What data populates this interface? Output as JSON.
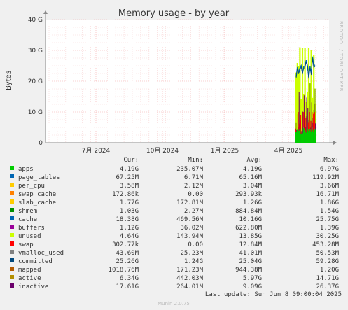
{
  "chart_data": {
    "type": "line",
    "title": "Memory usage - by year",
    "ylabel": "Bytes",
    "xlabel": "",
    "ylim": [
      0,
      40
    ],
    "y_unit": "G",
    "y_ticks": [
      "0",
      "10 G",
      "20 G",
      "30 G",
      "40 G"
    ],
    "x_ticks": [
      "7月 2024",
      "10月 2024",
      "1月 2025",
      "4月 2025"
    ],
    "grid": true,
    "legend_headers": [
      "Cur:",
      "Min:",
      "Avg:",
      "Max:"
    ],
    "series": [
      {
        "name": "apps",
        "color": "#00cc00",
        "cur": "4.19G",
        "min": "235.07M",
        "avg": "4.19G",
        "max": "6.97G"
      },
      {
        "name": "page_tables",
        "color": "#0066b3",
        "cur": "67.25M",
        "min": "6.71M",
        "avg": "65.16M",
        "max": "119.92M"
      },
      {
        "name": "per_cpu",
        "color": "#ff8000",
        "cur": "3.58M",
        "min": "2.12M",
        "avg": "3.04M",
        "max": "3.66M"
      },
      {
        "name": "swap_cache",
        "color": "#ffcc00",
        "cur": "172.86k",
        "min": "0.00",
        "avg": "293.93k",
        "max": "16.71M"
      },
      {
        "name": "slab_cache",
        "color": "#330099",
        "cur": "1.77G",
        "min": "172.81M",
        "avg": "1.26G",
        "max": "1.86G"
      },
      {
        "name": "shmem",
        "color": "#990099",
        "cur": "1.03G",
        "min": "2.27M",
        "avg": "884.84M",
        "max": "1.54G"
      },
      {
        "name": "cache",
        "color": "#ccff00",
        "cur": "18.38G",
        "min": "469.56M",
        "avg": "10.16G",
        "max": "25.75G"
      },
      {
        "name": "buffers",
        "color": "#ff0000",
        "cur": "1.12G",
        "min": "36.02M",
        "avg": "622.80M",
        "max": "1.39G"
      },
      {
        "name": "unused",
        "color": "#808080",
        "cur": "4.64G",
        "min": "143.94M",
        "avg": "13.85G",
        "max": "30.25G"
      },
      {
        "name": "swap",
        "color": "#008f00",
        "cur": "302.77k",
        "min": "0.00",
        "avg": "12.84M",
        "max": "453.28M"
      },
      {
        "name": "vmalloc_used",
        "color": "#00487d",
        "cur": "43.60M",
        "min": "25.23M",
        "avg": "41.01M",
        "max": "50.53M"
      },
      {
        "name": "committed",
        "color": "#b35a00",
        "cur": "25.26G",
        "min": "1.24G",
        "avg": "25.04G",
        "max": "59.28G"
      },
      {
        "name": "mapped",
        "color": "#b38f00",
        "cur": "1018.76M",
        "min": "171.23M",
        "avg": "944.38M",
        "max": "1.20G"
      },
      {
        "name": "active",
        "color": "#6b006b",
        "cur": "6.34G",
        "min": "442.03M",
        "avg": "5.97G",
        "max": "14.71G"
      },
      {
        "name": "inactive",
        "color": "#8fb300",
        "cur": "17.61G",
        "min": "264.01M",
        "avg": "9.09G",
        "max": "26.37G"
      }
    ],
    "legend_swatch_colors": [
      "#00cc00",
      "#0066b3",
      "#ffcc00",
      "#ff8000",
      "#ffcc00",
      "#008f00",
      "#0066b3",
      "#990099",
      "#ccff00",
      "#ff0000",
      "#808080",
      "#00487d",
      "#b35a00",
      "#b38f00",
      "#6b006b",
      "#ff0000"
    ],
    "stack_top_values": [
      [
        22.8,
        25.9,
        24.8,
        31.0,
        14.2,
        30.8,
        15.7,
        30.9,
        13.2,
        16.6,
        30.7,
        15.4,
        30.2,
        14.6,
        28.6,
        12.8
      ]
    ],
    "committed_values": [
      21.4,
      24.6,
      22.8,
      24.3,
      25.1,
      22.7,
      24.7,
      25.0,
      26.8,
      25.0,
      21.3,
      24.8,
      22.5,
      28.0,
      24.9,
      25.3
    ],
    "cache_values": [
      4.6,
      3.9,
      12.4,
      6.2,
      9.0,
      4.1,
      19.8,
      10.2,
      8.1,
      21.7,
      6.5,
      17.3,
      7.1,
      20.9,
      9.4,
      18.4
    ],
    "active_values": [
      4.1,
      9.3,
      16.5,
      7.2,
      3.8,
      10.1,
      15.4,
      5.0,
      14.7,
      11.3,
      8.7,
      4.9,
      13.1,
      6.4,
      12.6,
      6.3
    ],
    "inactive_values": [
      6.4,
      2.8,
      5.1,
      15.2,
      3.2,
      4.9,
      9.9,
      4.3,
      8.6,
      11.2,
      7.5,
      19.3,
      5.4,
      8.1,
      10.7,
      17.6
    ],
    "apps_values": [
      3.6,
      4.2,
      3.9,
      4.4,
      2.9,
      3.1,
      4.7,
      4.0,
      3.3,
      4.6,
      3.8,
      4.5,
      3.7,
      4.1,
      3.5,
      4.2
    ]
  },
  "footer": {
    "last_update": "Last update: Sun Jun  8 09:00:04 2025",
    "munin": "Munin 2.0.75",
    "side_label": "RRDTOOL / TOBI OETIKER"
  }
}
